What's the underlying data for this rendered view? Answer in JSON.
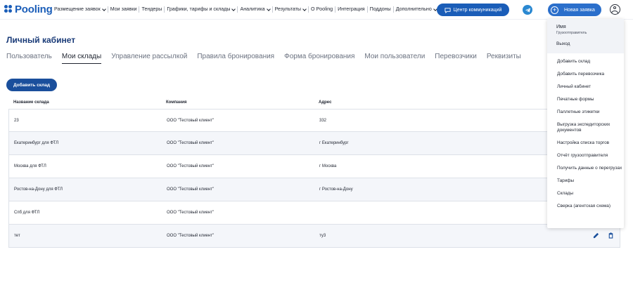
{
  "header": {
    "logo_text": "Pooling",
    "nav": [
      {
        "label": "Размещение заявок",
        "has_chevron": true
      },
      {
        "label": "Мои заявки",
        "has_chevron": false
      },
      {
        "label": "Тендеры",
        "has_chevron": false
      },
      {
        "label": "Графики, тарифы и склады",
        "has_chevron": true
      },
      {
        "label": "Аналитика",
        "has_chevron": true
      },
      {
        "label": "Результаты",
        "has_chevron": true
      },
      {
        "label": "О Pooling",
        "has_chevron": false
      },
      {
        "label": "Интеграция",
        "has_chevron": false
      },
      {
        "label": "Поддоны",
        "has_chevron": false
      },
      {
        "label": "Дополнительно",
        "has_chevron": true
      }
    ],
    "comm_center_label": "Центр коммуникаций",
    "new_request_label": "Новая заявка"
  },
  "page": {
    "title": "Личный кабинет",
    "tabs": [
      "Пользователь",
      "Мои склады",
      "Управление рассылкой",
      "Правила бронирования",
      "Форма бронирования",
      "Мои пользователи",
      "Перевозчики",
      "Реквизиты"
    ],
    "active_tab": "Мои склады",
    "add_warehouse_label": "Добавить склад"
  },
  "table": {
    "columns": [
      "Название склада",
      "Компания",
      "Адрес"
    ],
    "rows": [
      {
        "name": "23",
        "company": "ООО \"Тестовый клиент\"",
        "address": "332"
      },
      {
        "name": "Екатеринбург для ФТЛ",
        "company": "ООО \"Тестовый клиент\"",
        "address": "г Екатеринбург"
      },
      {
        "name": "Москва для ФТЛ",
        "company": "ООО \"Тестовый клиент\"",
        "address": "г Москва"
      },
      {
        "name": "Ростов-на-Дону для ФТЛ",
        "company": "ООО \"Тестовый клиент\"",
        "address": "г Ростов-на-Дону"
      },
      {
        "name": "Спб для ФТЛ",
        "company": "ООО \"Тестовый клиент\"",
        "address": ""
      },
      {
        "name": "тет",
        "company": "ООО \"Тестовый клиент\"",
        "address": "ту3"
      }
    ]
  },
  "user_menu": {
    "name": "Имя",
    "role": "Грузоотправитель",
    "logout": "Выход",
    "items": [
      "Добавить склад",
      "Добавить перевозчика",
      "Личный кабинет",
      "Печатные формы",
      "Паллетные этикетки",
      "Выгрузка экспедиторских документов",
      "Настройка списка торгов",
      "Отчёт грузоотправителя",
      "Получить данные о перегрузах",
      "Тарифы",
      "Склады",
      "Сверка (агентская схема)"
    ]
  },
  "colors": {
    "brand": "#1a5db8",
    "title": "#1a3b78",
    "row_alt": "#f4f6fa"
  },
  "icons": [
    "chat-icon",
    "telegram-icon",
    "plus-icon",
    "user-avatar-icon",
    "edit-icon",
    "trash-icon"
  ]
}
